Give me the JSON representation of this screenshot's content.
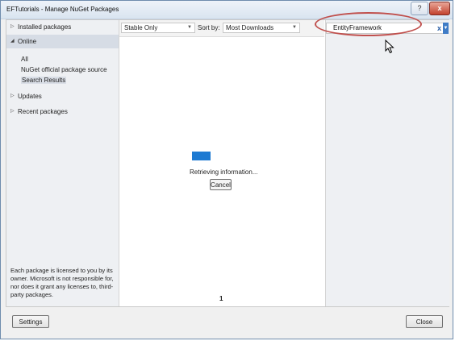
{
  "window": {
    "title": "EFTutorials - Manage NuGet Packages"
  },
  "titlebar": {
    "help_label": "?",
    "close_label": "x"
  },
  "sidebar": {
    "items": [
      {
        "label": "Installed packages"
      },
      {
        "label": "Online"
      },
      {
        "label": "Updates"
      },
      {
        "label": "Recent packages"
      }
    ],
    "online_sources": [
      "All",
      "NuGet official package source",
      "Search Results"
    ],
    "license_text": "Each package is licensed to you by its owner. Microsoft is not responsible for, nor does it grant any licenses to, third-party packages."
  },
  "toolbar": {
    "release_filter": "Stable Only",
    "sort_label": "Sort by:",
    "sort_value": "Most Downloads"
  },
  "search": {
    "value": "EntityFramework",
    "clear_label": "x"
  },
  "main": {
    "status_text": "Retrieving information...",
    "cancel_label": "Cancel",
    "page_number": "1"
  },
  "footer": {
    "settings_label": "Settings",
    "close_label": "Close"
  },
  "colors": {
    "progress": "#1e7ad2",
    "annotation": "#c0504d",
    "selected_item": "#d6dce5"
  }
}
